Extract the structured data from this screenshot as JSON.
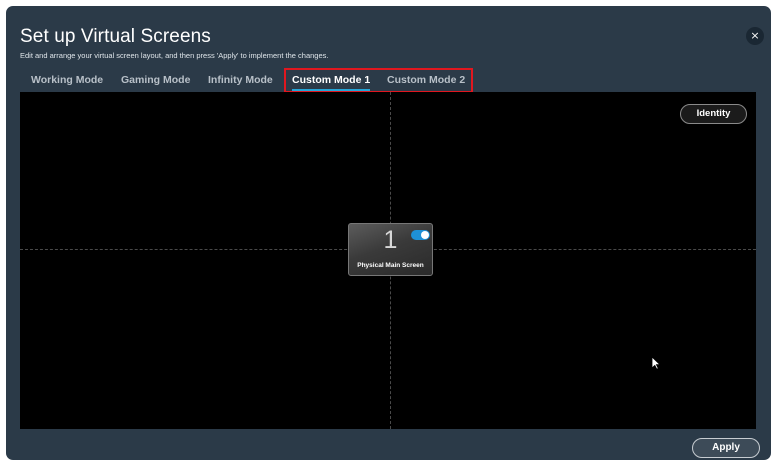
{
  "dialog": {
    "title": "Set up Virtual Screens",
    "subtitle": "Edit and arrange your virtual screen layout, and then press 'Apply' to implement the changes.",
    "close_icon": "×"
  },
  "tabs": [
    {
      "label": "Working Mode",
      "active": false
    },
    {
      "label": "Gaming Mode",
      "active": false
    },
    {
      "label": "Infinity Mode",
      "active": false
    },
    {
      "label": "Custom Mode 1",
      "active": true
    },
    {
      "label": "Custom Mode 2",
      "active": false
    }
  ],
  "canvas": {
    "identity_label": "Identity",
    "screens": [
      {
        "number": "1",
        "label": "Physical Main Screen",
        "enabled": true
      }
    ]
  },
  "footer": {
    "apply_label": "Apply"
  },
  "colors": {
    "window_bg": "#2b3a48",
    "canvas_bg": "#000000",
    "accent": "#25a7d8",
    "highlight": "#e0171f",
    "toggle_on": "#1e90d6"
  }
}
